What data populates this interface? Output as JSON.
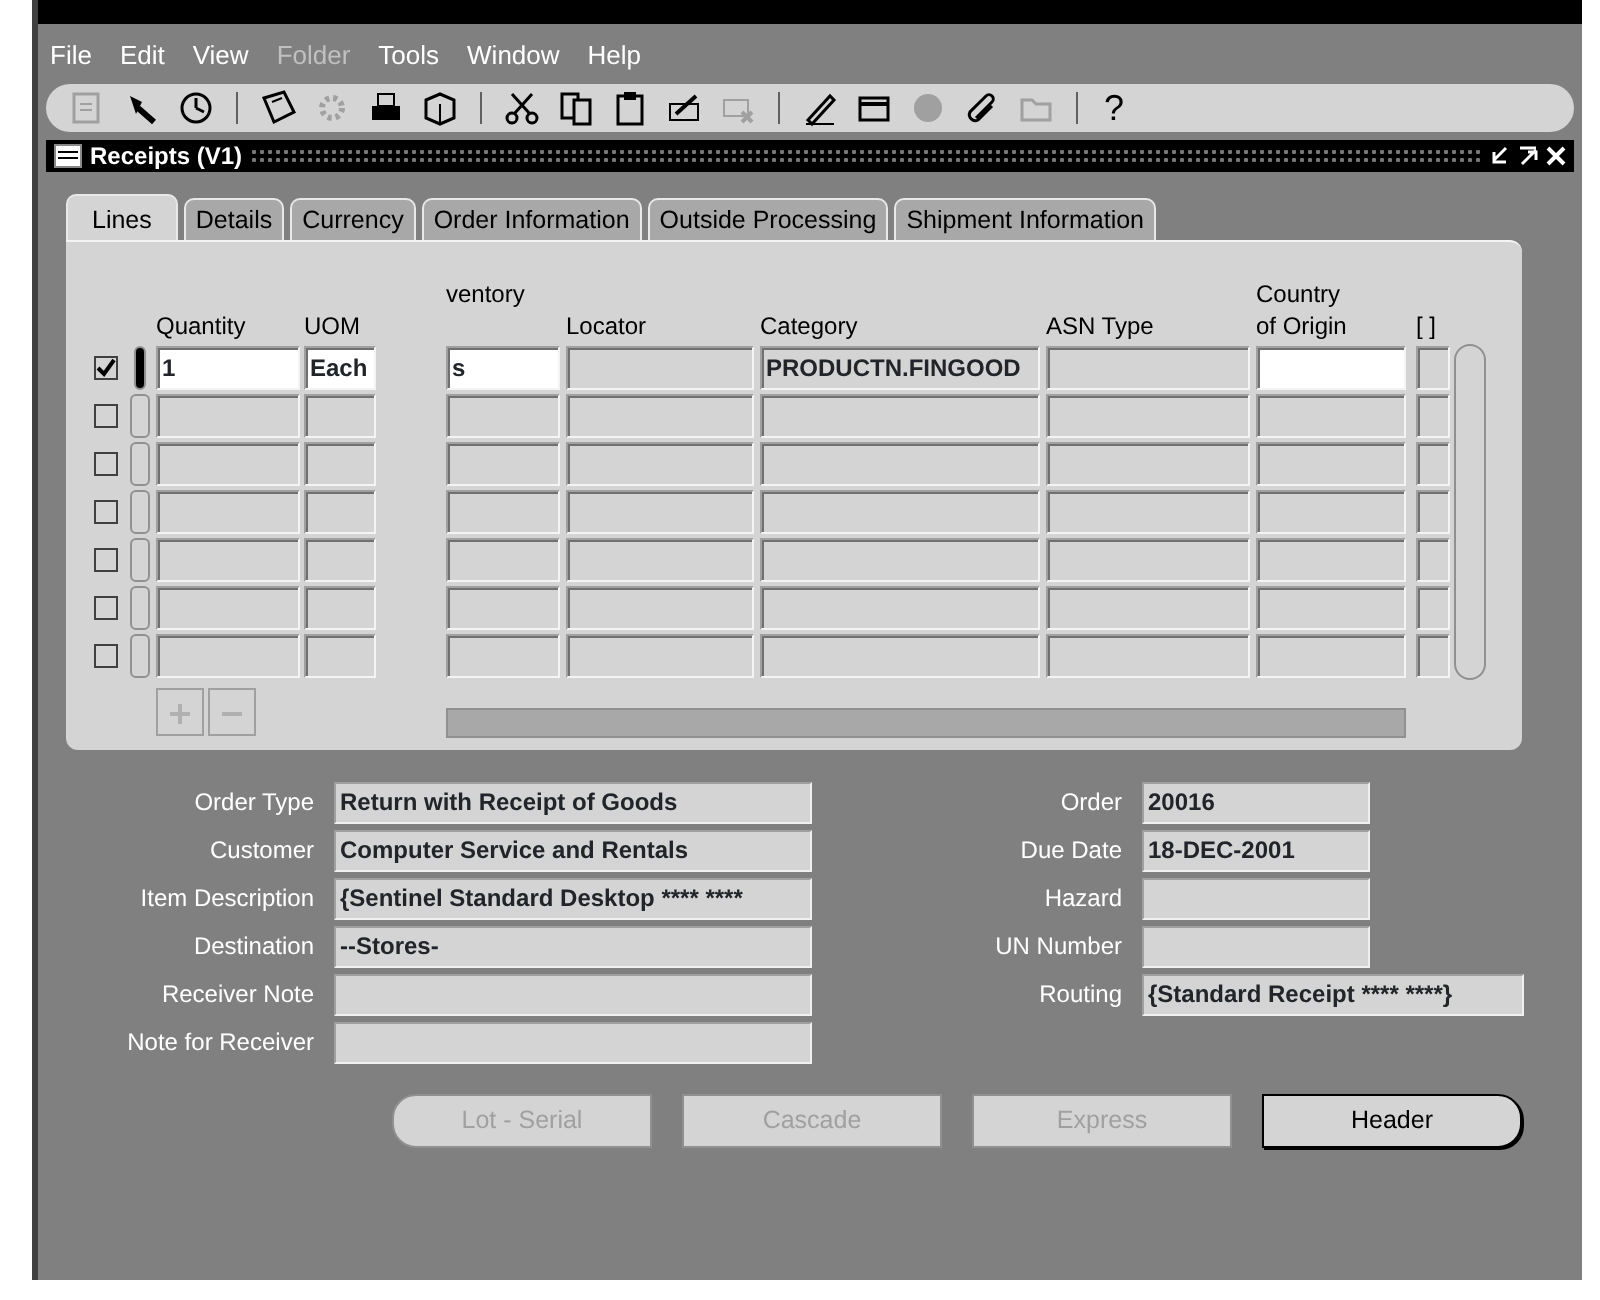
{
  "menu": [
    {
      "label": "File",
      "disabled": false
    },
    {
      "label": "Edit",
      "disabled": false
    },
    {
      "label": "View",
      "disabled": false
    },
    {
      "label": "Folder",
      "disabled": true
    },
    {
      "label": "Tools",
      "disabled": false
    },
    {
      "label": "Window",
      "disabled": false
    },
    {
      "label": "Help",
      "disabled": false
    }
  ],
  "toolbar": [
    {
      "kind": "icon",
      "disabled": true
    },
    {
      "kind": "icon",
      "disabled": false
    },
    {
      "kind": "icon",
      "disabled": false
    },
    {
      "kind": "separator"
    },
    {
      "kind": "icon",
      "disabled": false
    },
    {
      "kind": "icon",
      "disabled": true
    },
    {
      "kind": "icon",
      "disabled": false
    },
    {
      "kind": "icon",
      "disabled": false
    },
    {
      "kind": "separator"
    },
    {
      "kind": "icon",
      "disabled": false
    },
    {
      "kind": "icon",
      "disabled": false
    },
    {
      "kind": "icon",
      "disabled": false
    },
    {
      "kind": "icon",
      "disabled": false
    },
    {
      "kind": "icon",
      "disabled": true
    },
    {
      "kind": "separator"
    },
    {
      "kind": "icon",
      "disabled": false
    },
    {
      "kind": "icon",
      "disabled": false
    },
    {
      "kind": "icon",
      "disabled": true
    },
    {
      "kind": "icon",
      "disabled": false
    },
    {
      "kind": "icon",
      "disabled": true
    },
    {
      "kind": "separator"
    },
    {
      "kind": "glyph",
      "text": "?",
      "disabled": false
    }
  ],
  "window": {
    "title": "Receipts (V1)"
  },
  "tabs": [
    {
      "label": "Lines",
      "selected": true
    },
    {
      "label": "Details",
      "selected": false
    },
    {
      "label": "Currency",
      "selected": false
    },
    {
      "label": "Order Information",
      "selected": false
    },
    {
      "label": "Outside Processing",
      "selected": false
    },
    {
      "label": "Shipment Information",
      "selected": false
    }
  ],
  "table": {
    "columns": [
      {
        "label": "Quantity"
      },
      {
        "label": "UOM"
      },
      {
        "label_top": "ventory"
      },
      {
        "label": "Locator"
      },
      {
        "label": "Category"
      },
      {
        "label": "ASN Type"
      },
      {
        "label_top": "Country",
        "label": "of Origin"
      },
      {
        "label": "[ ]"
      }
    ],
    "rows": [
      {
        "checked": true,
        "current": true,
        "cells": [
          {
            "text": "1",
            "editable": true
          },
          {
            "text": "Each",
            "editable": true
          },
          {
            "text": "s",
            "editable": true
          },
          {
            "editable": false
          },
          {
            "text": "PRODUCTN.FINGOOD",
            "editable": false
          },
          {
            "editable": false
          },
          {
            "editable": true
          },
          {
            "editable": false
          }
        ]
      },
      {
        "checked": false,
        "current": false,
        "cells": [
          {
            "editable": false
          },
          {
            "editable": false
          },
          {
            "editable": false
          },
          {
            "editable": false
          },
          {
            "editable": false
          },
          {
            "editable": false
          },
          {
            "editable": false
          },
          {
            "editable": false
          }
        ]
      },
      {
        "checked": false,
        "current": false,
        "cells": [
          {
            "editable": false
          },
          {
            "editable": false
          },
          {
            "editable": false
          },
          {
            "editable": false
          },
          {
            "editable": false
          },
          {
            "editable": false
          },
          {
            "editable": false
          },
          {
            "editable": false
          }
        ]
      },
      {
        "checked": false,
        "current": false,
        "cells": [
          {
            "editable": false
          },
          {
            "editable": false
          },
          {
            "editable": false
          },
          {
            "editable": false
          },
          {
            "editable": false
          },
          {
            "editable": false
          },
          {
            "editable": false
          },
          {
            "editable": false
          }
        ]
      },
      {
        "checked": false,
        "current": false,
        "cells": [
          {
            "editable": false
          },
          {
            "editable": false
          },
          {
            "editable": false
          },
          {
            "editable": false
          },
          {
            "editable": false
          },
          {
            "editable": false
          },
          {
            "editable": false
          },
          {
            "editable": false
          }
        ]
      },
      {
        "checked": false,
        "current": false,
        "cells": [
          {
            "editable": false
          },
          {
            "editable": false
          },
          {
            "editable": false
          },
          {
            "editable": false
          },
          {
            "editable": false
          },
          {
            "editable": false
          },
          {
            "editable": false
          },
          {
            "editable": false
          }
        ]
      },
      {
        "checked": false,
        "current": false,
        "cells": [
          {
            "editable": false
          },
          {
            "editable": false
          },
          {
            "editable": false
          },
          {
            "editable": false
          },
          {
            "editable": false
          },
          {
            "editable": false
          },
          {
            "editable": false
          },
          {
            "editable": false
          }
        ]
      }
    ]
  },
  "left_fields": [
    {
      "label": "Order Type",
      "value": "Return with Receipt of Goods"
    },
    {
      "label": "Customer",
      "value": "Computer Service and Rentals"
    },
    {
      "label": "Item Description",
      "value": "{Sentinel Standard Desktop **** ****"
    },
    {
      "label": "Destination",
      "value": "--Stores-"
    },
    {
      "label": "Receiver Note"
    },
    {
      "label": "Note for Receiver"
    }
  ],
  "right_fields": [
    {
      "label": "Order",
      "value": "20016"
    },
    {
      "label": "Due Date",
      "value": "18-DEC-2001"
    },
    {
      "label": "Hazard"
    },
    {
      "label": "UN Number"
    },
    {
      "label": "Routing",
      "value": "{Standard Receipt **** ****}",
      "wide": true
    }
  ],
  "buttons": [
    {
      "label": "Lot - Serial",
      "disabled": true
    },
    {
      "label": "Cascade",
      "disabled": true
    },
    {
      "label": "Express",
      "disabled": true
    },
    {
      "label": "Header",
      "disabled": false
    }
  ]
}
